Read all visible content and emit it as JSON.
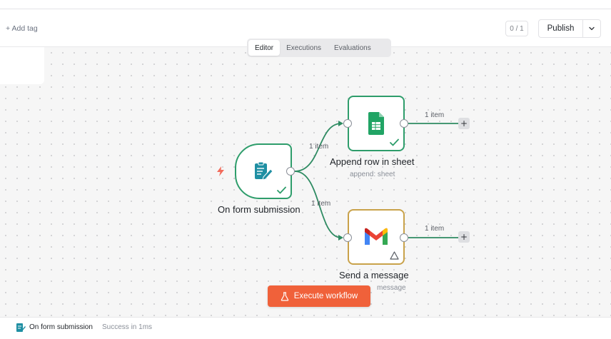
{
  "header": {
    "add_tag": "+ Add tag",
    "counter": "0 / 1",
    "publish_label": "Publish"
  },
  "tabs": [
    {
      "label": "Editor",
      "active": true
    },
    {
      "label": "Executions",
      "active": false
    },
    {
      "label": "Evaluations",
      "active": false
    }
  ],
  "nodes": {
    "trigger": {
      "title": "On form submission",
      "icon": "form-icon",
      "status": "success"
    },
    "sheet": {
      "title": "Append row in sheet",
      "subtitle": "append: sheet",
      "icon": "google-sheets-icon",
      "status": "success"
    },
    "gmail": {
      "title": "Send a message",
      "subtitle": "message",
      "icon": "gmail-icon",
      "status": "warning"
    }
  },
  "edges": {
    "trigger_to_sheet": "1 item",
    "trigger_to_gmail": "1 item",
    "sheet_out": "1 item",
    "gmail_out": "1 item"
  },
  "execute_label": "Execute workflow",
  "log": {
    "node_name": "On form submission",
    "status": "Success in 1ms"
  },
  "colors": {
    "accent": "#f0613a",
    "success": "#2e9d6b",
    "warning": "#c9a24a"
  }
}
